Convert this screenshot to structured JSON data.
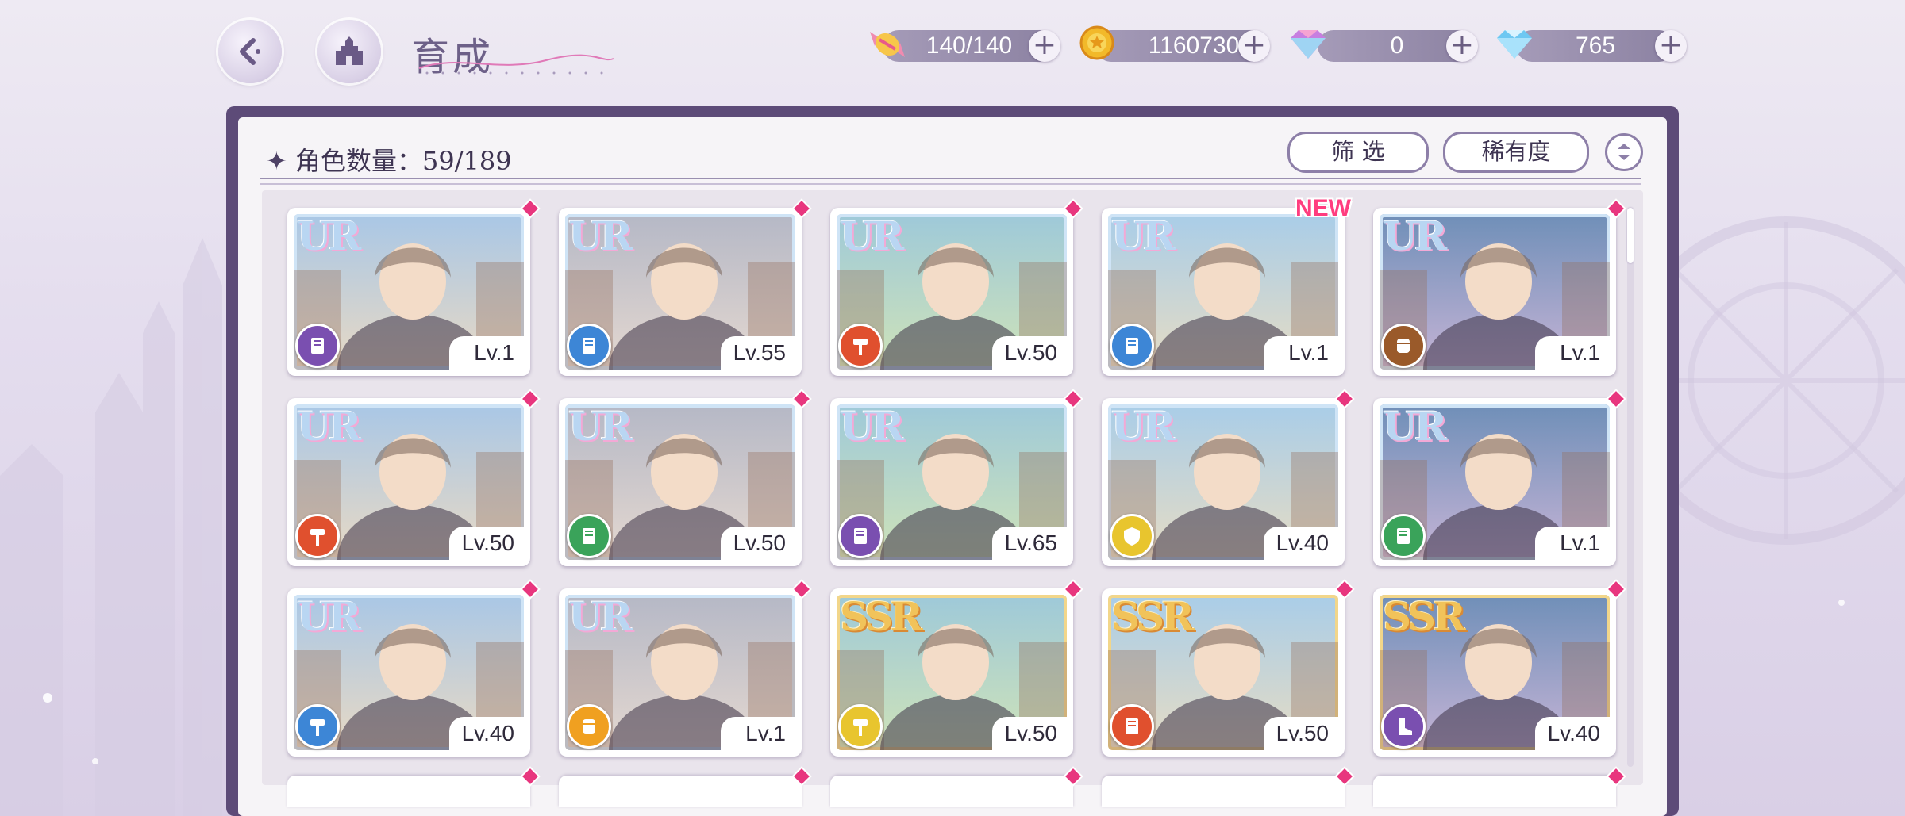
{
  "header": {
    "title": "育成",
    "back_icon": "back-arrow-icon",
    "home_icon": "castle-icon"
  },
  "resources": [
    {
      "name": "stamina",
      "icon": "candy-icon",
      "value": "140/140"
    },
    {
      "name": "gold",
      "icon": "coin-icon",
      "value": "1160730"
    },
    {
      "name": "paid-gem",
      "icon": "rainbow-diamond-icon",
      "value": "0"
    },
    {
      "name": "free-gem",
      "icon": "blue-diamond-icon",
      "value": "765"
    }
  ],
  "panel": {
    "count_label": "角色数量：59/189",
    "filter_label": "筛 选",
    "sort_label": "稀有度"
  },
  "colors": {
    "attr_purple": "#7a4fb0",
    "attr_blue": "#3d86d6",
    "attr_red": "#e0502e",
    "attr_brown": "#9a5a2a",
    "attr_green": "#3aa35a",
    "attr_yellow": "#e8c52e",
    "attr_orange": "#f0a020",
    "gem_pink": "#e8367e"
  },
  "cards": [
    {
      "rarity": "UR",
      "level": "Lv.1",
      "attr": "attr_purple",
      "attr_icon": "book-icon",
      "new": false
    },
    {
      "rarity": "UR",
      "level": "Lv.55",
      "attr": "attr_blue",
      "attr_icon": "book-icon",
      "new": false
    },
    {
      "rarity": "UR",
      "level": "Lv.50",
      "attr": "attr_red",
      "attr_icon": "hammer-icon",
      "new": false
    },
    {
      "rarity": "UR",
      "level": "Lv.1",
      "attr": "attr_blue",
      "attr_icon": "book-icon",
      "new": true,
      "new_label": "NEW"
    },
    {
      "rarity": "UR",
      "level": "Lv.1",
      "attr": "attr_brown",
      "attr_icon": "fist-icon",
      "new": false
    },
    {
      "rarity": "UR",
      "level": "Lv.50",
      "attr": "attr_red",
      "attr_icon": "hammer-icon",
      "new": false
    },
    {
      "rarity": "UR",
      "level": "Lv.50",
      "attr": "attr_green",
      "attr_icon": "book-icon",
      "new": false
    },
    {
      "rarity": "UR",
      "level": "Lv.65",
      "attr": "attr_purple",
      "attr_icon": "book-icon",
      "new": false
    },
    {
      "rarity": "UR",
      "level": "Lv.40",
      "attr": "attr_yellow",
      "attr_icon": "shield-icon",
      "new": false
    },
    {
      "rarity": "UR",
      "level": "Lv.1",
      "attr": "attr_green",
      "attr_icon": "book-icon",
      "new": false
    },
    {
      "rarity": "UR",
      "level": "Lv.40",
      "attr": "attr_blue",
      "attr_icon": "hammer-icon",
      "new": false
    },
    {
      "rarity": "UR",
      "level": "Lv.1",
      "attr": "attr_orange",
      "attr_icon": "fist-icon",
      "new": false
    },
    {
      "rarity": "SSR",
      "level": "Lv.50",
      "attr": "attr_yellow",
      "attr_icon": "hammer-icon",
      "new": false
    },
    {
      "rarity": "SSR",
      "level": "Lv.50",
      "attr": "attr_red",
      "attr_icon": "book-icon",
      "new": false
    },
    {
      "rarity": "SSR",
      "level": "Lv.40",
      "attr": "attr_purple",
      "attr_icon": "boot-icon",
      "new": false
    }
  ]
}
